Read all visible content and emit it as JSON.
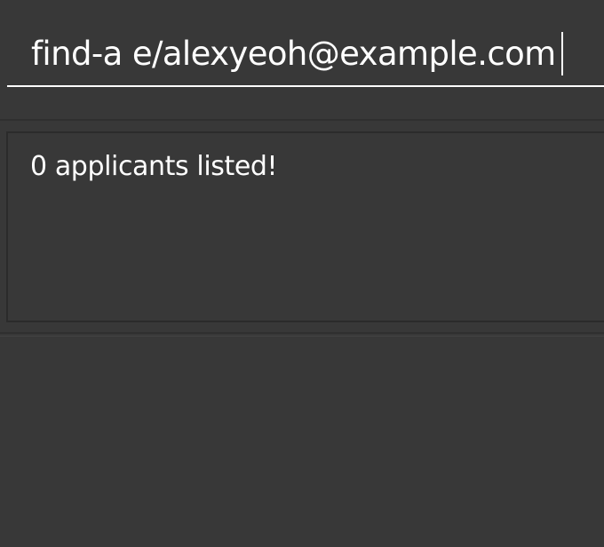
{
  "command_box": {
    "value": "find-a e/alexyeoh@example.com"
  },
  "result_display": {
    "message": "0 applicants listed!"
  },
  "colors": {
    "background": "#383838",
    "text": "#ffffff",
    "panel_border": "#2b2b2b"
  }
}
